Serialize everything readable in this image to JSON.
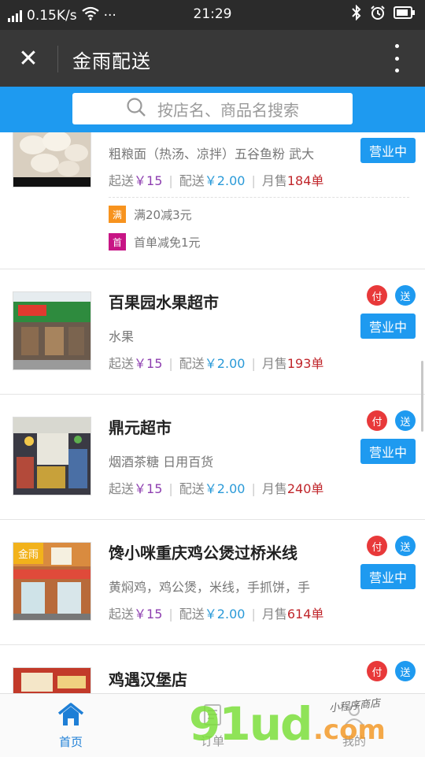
{
  "status_bar": {
    "speed": "0.15K/s",
    "dots": "···",
    "time": "21:29"
  },
  "header": {
    "close_glyph": "✕",
    "title": "金雨配送"
  },
  "search": {
    "placeholder": "按店名、商品名搜索"
  },
  "shops": [
    {
      "name": "",
      "categories": "粗粮面（热汤、凉拌）五谷鱼粉 武大",
      "min_label": "起送",
      "min_value": "￥15",
      "fee_label": "配送",
      "fee_value": "￥2.00",
      "sales_label": "月售",
      "sales_value": "184单",
      "status": "营业中",
      "promos": [
        {
          "tag": "满",
          "text": "满20减3元",
          "color": "#f7931e"
        },
        {
          "tag": "首",
          "text": "首单减免1元",
          "color": "#c71585"
        }
      ]
    },
    {
      "name": "百果园水果超市",
      "categories": "水果",
      "min_label": "起送",
      "min_value": "￥15",
      "fee_label": "配送",
      "fee_value": "￥2.00",
      "sales_label": "月售",
      "sales_value": "193单",
      "status": "营业中",
      "pay_badge": "付",
      "deliver_badge": "送"
    },
    {
      "name": "鼎元超市",
      "categories": "烟酒茶糖 日用百货",
      "min_label": "起送",
      "min_value": "￥15",
      "fee_label": "配送",
      "fee_value": "￥2.00",
      "sales_label": "月售",
      "sales_value": "240单",
      "status": "营业中",
      "pay_badge": "付",
      "deliver_badge": "送"
    },
    {
      "name": "馋小咪重庆鸡公煲过桥米线",
      "categories": "黄焖鸡，鸡公煲，米线，手抓饼，手",
      "min_label": "起送",
      "min_value": "￥15",
      "fee_label": "配送",
      "fee_value": "￥2.00",
      "sales_label": "月售",
      "sales_value": "614单",
      "status": "营业中",
      "pay_badge": "付",
      "deliver_badge": "送",
      "thumb_badge": "金雨"
    },
    {
      "name": "鸡遇汉堡店",
      "pay_badge": "付",
      "deliver_badge": "送"
    }
  ],
  "tabs": [
    {
      "label": "首页"
    },
    {
      "label": "订单"
    },
    {
      "label": "我的"
    }
  ],
  "watermark": {
    "brand": "91ud",
    "suffix": ".com",
    "note": "小程序商店"
  },
  "colors": {
    "primary": "#1e9af0",
    "header": "#383838",
    "purple": "#8e3fb0",
    "red": "#c0262b",
    "badge_red": "#e8393a"
  }
}
